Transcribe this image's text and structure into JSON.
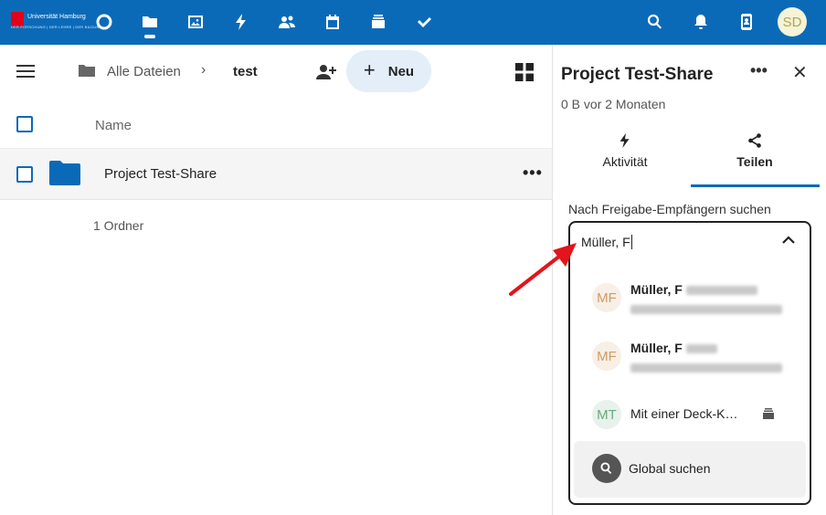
{
  "header": {
    "logo": {
      "name": "Universität Hamburg",
      "tagline": "DER FORSCHUNG | DER LEHRE | DER BILDUNG"
    },
    "apps": [
      {
        "icon": "dashboard-circle-icon",
        "label": "Dashboard"
      },
      {
        "icon": "folder-icon",
        "label": "Dateien",
        "active": true
      },
      {
        "icon": "image-icon",
        "label": "Fotos"
      },
      {
        "icon": "lightning-icon",
        "label": "Aktivität"
      },
      {
        "icon": "contacts-group-icon",
        "label": "Kontakte"
      },
      {
        "icon": "calendar-icon",
        "label": "Kalender"
      },
      {
        "icon": "deck-icon",
        "label": "Deck"
      },
      {
        "icon": "check-icon",
        "label": "Aufgaben"
      }
    ],
    "user_initials": "SD",
    "accent": "#0b6ab8"
  },
  "files": {
    "breadcrumb": {
      "root": "Alle Dateien",
      "separator": "›",
      "current": "test"
    },
    "new_button": "Neu",
    "column_name": "Name",
    "rows": [
      {
        "name": "Project Test-Share",
        "type": "folder",
        "menu": "•••"
      }
    ],
    "summary": "1 Ordner"
  },
  "sidebar": {
    "title": "Project Test-Share",
    "more": "•••",
    "close": "✕",
    "subtitle": "0 B vor 2 Monaten",
    "tabs": [
      {
        "label": "Aktivität",
        "icon": "lightning-icon",
        "active": false
      },
      {
        "label": "Teilen",
        "icon": "share-icon",
        "active": true
      }
    ],
    "search_label": "Nach Freigabe-Empfängern suchen",
    "search_value": "Müller, F",
    "results": [
      {
        "initials": "MF",
        "name": "Müller, F"
      },
      {
        "initials": "MF",
        "name": "Müller, F"
      },
      {
        "initials": "MT",
        "name": "Mit einer Deck-K…",
        "icon": "deck-icon"
      }
    ],
    "global_search": "Global suchen"
  }
}
